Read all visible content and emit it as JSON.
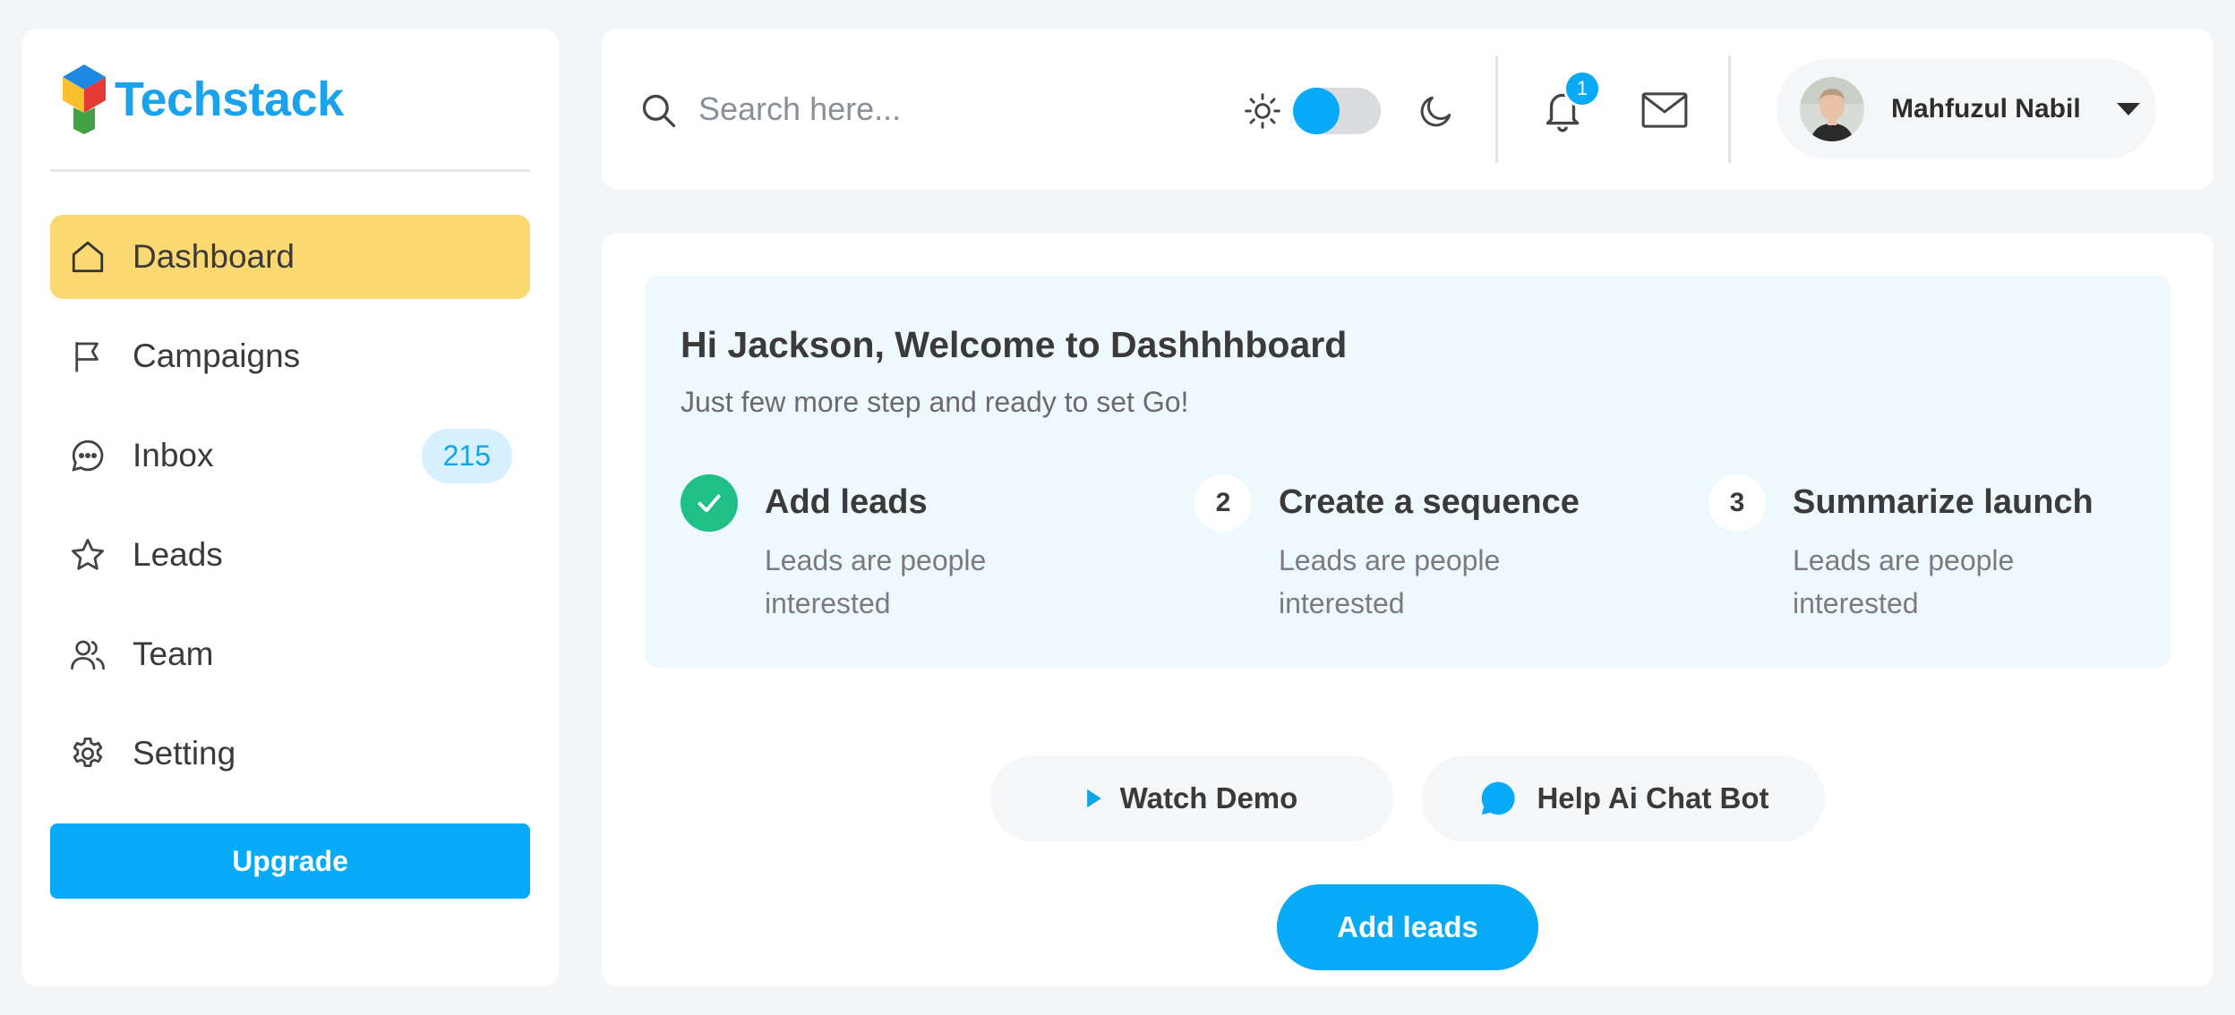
{
  "brand": {
    "name": "Techstack",
    "colors": [
      "#e53935",
      "#43a047",
      "#1e88e5",
      "#fbc02d"
    ]
  },
  "sidebar": {
    "items": [
      {
        "label": "Dashboard",
        "icon": "home-icon",
        "active": true
      },
      {
        "label": "Campaigns",
        "icon": "flag-icon"
      },
      {
        "label": "Inbox",
        "icon": "chat-bubble-icon",
        "badge": "215"
      },
      {
        "label": "Leads",
        "icon": "star-icon"
      },
      {
        "label": "Team",
        "icon": "users-icon"
      },
      {
        "label": "Setting",
        "icon": "gear-icon"
      }
    ],
    "upgrade_label": "Upgrade"
  },
  "header": {
    "search_placeholder": "Search here...",
    "theme_toggle": {
      "state": "light"
    },
    "notifications_count": "1",
    "user_name": "Mahfuzul Nabil"
  },
  "welcome": {
    "title": "Hi Jackson, Welcome to Dashhhboard",
    "subtitle": "Just few more step and ready to set Go!",
    "steps": [
      {
        "mark": "",
        "done": true,
        "title": "Add leads",
        "desc": "Leads are people interested"
      },
      {
        "mark": "2",
        "done": false,
        "title": "Create a sequence",
        "desc": "Leads are people interested"
      },
      {
        "mark": "3",
        "done": false,
        "title": "Summarize launch",
        "desc": "Leads are people interested"
      }
    ]
  },
  "actions": {
    "watch_demo_label": "Watch Demo",
    "chat_bot_label": "Help Ai Chat Bot",
    "add_leads_label": "Add leads"
  },
  "colors": {
    "accent": "#06aaf7",
    "active_nav": "#fbd872",
    "success": "#1ec088",
    "welcome_bg": "#eef9fd"
  }
}
